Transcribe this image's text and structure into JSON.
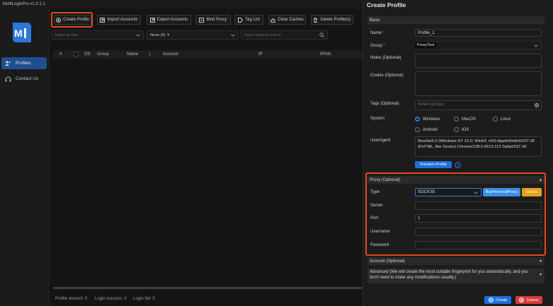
{
  "app": {
    "title": "MultiLoginPro  v1.0.1.1"
  },
  "sidebar": {
    "logo_text": "ML",
    "items": [
      {
        "label": "Profiles",
        "icon": "users-icon"
      },
      {
        "label": "Contact Us",
        "icon": "headset-icon"
      }
    ]
  },
  "toolbar": {
    "buttons": [
      {
        "label": "Create Profile",
        "icon": "plus-circle-icon"
      },
      {
        "label": "Import Accounts",
        "icon": "import-icon"
      },
      {
        "label": "Export Accounts",
        "icon": "export-icon"
      },
      {
        "label": "Bind Proxy",
        "icon": "link-icon"
      },
      {
        "label": "Tag List",
        "icon": "tag-icon"
      },
      {
        "label": "Clear Caches",
        "icon": "broom-icon"
      },
      {
        "label": "Delete Profile(s)",
        "icon": "trash-icon"
      }
    ]
  },
  "filters": {
    "groups_placeholder": "Select groups",
    "tag_value": "None (0)",
    "search_placeholder": "Input name to search"
  },
  "table": {
    "columns": [
      "#",
      "OS",
      "Group",
      "Name",
      "Account",
      "IP",
      "IPInfo"
    ]
  },
  "footer": {
    "profile_amount": "Profile amount: 0",
    "login_success": "Login success: 0",
    "login_fail": "Login fail: 0"
  },
  "panel": {
    "title": "Create Profile",
    "basic_header": "Basic",
    "name_label": "Name",
    "name_value": "Profile_1",
    "group_label": "Group",
    "group_value": "ProxyTest",
    "notes_label": "Notes (Optional)",
    "cookie_label": "Cookie (Optional)",
    "tags_label": "Tags (Optional)",
    "tags_placeholder": "Select groups",
    "system_label": "System",
    "systems": [
      "Windows",
      "MacOS",
      "Linux",
      "Android",
      "IOS"
    ],
    "useragent_label": "UserAgent",
    "useragent_value": "Mozilla/5.0 (Windows NT 10.0; Win64; x64) AppleWebKit/537.36 (KHTML, like Gecko) Chrome/128.0.6613.113 Safari/537.36",
    "random_profile": "Random Profile",
    "proxy_header": "Proxy (Optional)",
    "type_label": "Type",
    "type_value": "SOCKS5",
    "buy_proxy": "BuyPersonalProxy",
    "check": "Check",
    "server_label": "Server",
    "port_label": "Port",
    "port_value": "1",
    "username_label": "Username",
    "password_label": "Password",
    "account_header": "Account (Optional)",
    "advanced_text": "Advanced (We will create the most suitable fingerprint for you automatically, and you don't need to make any modifications usually.)",
    "create": "Create",
    "cancel": "Cancel"
  },
  "colors": {
    "accent": "#1f6fdc",
    "highlight": "#e3481f",
    "check": "#e8a21a",
    "cancel": "#d93a3a"
  }
}
